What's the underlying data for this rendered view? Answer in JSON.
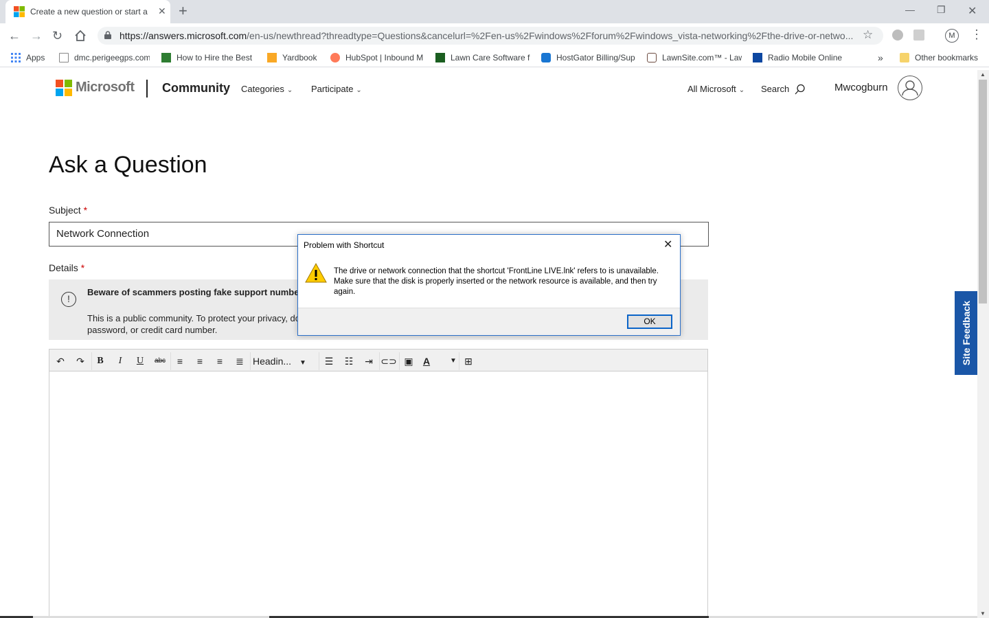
{
  "browser": {
    "tab_title": "Create a new question or start a",
    "url_host": "https://answers.microsoft.com",
    "url_path": "/en-us/newthread?threadtype=Questions&cancelurl=%2Fen-us%2Fwindows%2Fforum%2Fwindows_vista-networking%2Fthe-drive-or-netwo...",
    "profile_initial": "M",
    "bookmarks": [
      {
        "label": "Apps",
        "icon": "apps-grid-icon",
        "color": "#4285f4"
      },
      {
        "label": "dmc.perigeegps.com",
        "icon": "page-icon",
        "color": "#888888"
      },
      {
        "label": "How to Hire the Best",
        "icon": "sl-icon",
        "color": "#2e7d32"
      },
      {
        "label": "Yardbook",
        "icon": "yardbook-icon",
        "color": "#f9a825"
      },
      {
        "label": "HubSpot | Inbound M",
        "icon": "hubspot-icon",
        "color": "#ff7a59"
      },
      {
        "label": "Lawn Care Software f",
        "icon": "lawncare-icon",
        "color": "#1b5e20"
      },
      {
        "label": "HostGator Billing/Sup",
        "icon": "hostgator-icon",
        "color": "#1976d2"
      },
      {
        "label": "LawnSite.com™ - Law",
        "icon": "lawnsite-icon",
        "color": "#6d4c41"
      },
      {
        "label": "Radio Mobile Online",
        "icon": "radio-mobile-icon",
        "color": "#0d47a1"
      }
    ],
    "overflow": "»",
    "other_bookmarks": "Other bookmarks"
  },
  "header": {
    "brand": "Microsoft",
    "community": "Community",
    "nav": [
      "Categories",
      "Participate"
    ],
    "all_microsoft": "All Microsoft",
    "search": "Search",
    "username": "Mwcogburn"
  },
  "page": {
    "title": "Ask a Question",
    "subject_label": "Subject",
    "required_mark": "*",
    "subject_value": "Network Connection",
    "details_label": "Details",
    "alert_bold": "Beware of scammers posting fake support numbers here. Microsoft does not provide phone numbers for support. If you need help.",
    "alert_text": "This is a public community. To protect your privacy, do not post any personal information such as your email address, phone number, product key, password, or credit card number.",
    "heading_dropdown": "Headin...",
    "site_feedback": "Site Feedback"
  },
  "dialog": {
    "title": "Problem with Shortcut",
    "message": "The drive or network connection that the shortcut 'FrontLine LIVE.lnk' refers to is unavailable. Make sure that the disk is properly inserted or the network resource is available, and then try again.",
    "ok_label": "OK"
  },
  "colors": {
    "feedback_blue": "#1a56a7",
    "dialog_border": "#2a6fc9",
    "required_red": "#cc0000"
  }
}
